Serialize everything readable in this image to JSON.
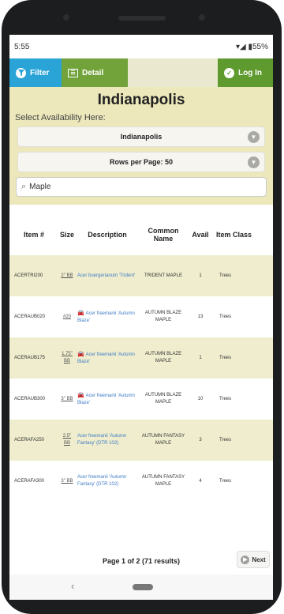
{
  "status": {
    "time": "5:55",
    "indicators": "▾◢ ▮55%"
  },
  "toolbar": {
    "filter_label": "Filter",
    "detail_label": "Detail",
    "login_label": "Log In"
  },
  "header": {
    "city": "Indianapolis",
    "availability_label": "Select Availability Here:"
  },
  "selects": {
    "location_value": "Indianapolis",
    "rows_per_page_value": "Rows per Page: 50"
  },
  "search": {
    "value": "Maple"
  },
  "table": {
    "headers": {
      "item": "Item #",
      "size": "Size",
      "description": "Description",
      "common_name": "Common Name",
      "avail": "Avail",
      "item_class": "Item Class"
    },
    "rows": [
      {
        "item": "ACERTRI200",
        "size": "2\" BB",
        "description": "Acer buergerianum 'Trident'",
        "common": "TRIDENT MAPLE",
        "avail": "1",
        "class": "Trees",
        "icon": false
      },
      {
        "item": "ACERAUB020",
        "size": "#20",
        "description": "Acer freemanii 'Autumn Blaze'",
        "common": "AUTUMN BLAZE MAPLE",
        "avail": "13",
        "class": "Trees",
        "icon": true
      },
      {
        "item": "ACERAUB175",
        "size": "1.75\" BB",
        "description": "Acer freemanii 'Autumn Blaze'",
        "common": "AUTUMN BLAZE MAPLE",
        "avail": "1",
        "class": "Trees",
        "icon": true
      },
      {
        "item": "ACERAUB300",
        "size": "3\" BB",
        "description": "Acer freemanii 'Autumn Blaze'",
        "common": "AUTUMN BLAZE MAPLE",
        "avail": "10",
        "class": "Trees",
        "icon": true
      },
      {
        "item": "ACERAFA250",
        "size": "2.5\" BB",
        "description": "Acer freemanii 'Autumn Fantasy' (DTR 102)",
        "common": "AUTUMN FANTASY MAPLE",
        "avail": "3",
        "class": "Trees",
        "icon": false
      },
      {
        "item": "ACERAFA300",
        "size": "3\" BB",
        "description": "Acer freemanii 'Autumn Fantasy' (DTR 102)",
        "common": "AUTUMN FANTASY MAPLE",
        "avail": "4",
        "class": "Trees",
        "icon": false
      }
    ]
  },
  "footer": {
    "page_info": "Page 1 of 2 (71 results)",
    "next_label": "Next"
  },
  "icons": {
    "filter": "filter-icon",
    "detail": "list-icon",
    "login": "check-icon",
    "search": "search-icon",
    "chevron": "chevron-down-icon",
    "next": "arrow-right-icon",
    "availability": "car-icon"
  },
  "colors": {
    "filter": "#2aa3d6",
    "detail": "#72a33a",
    "login": "#5f9a2f",
    "panel": "#ece8bb",
    "row_alt": "#efedcd",
    "link": "#3e7bc6"
  }
}
